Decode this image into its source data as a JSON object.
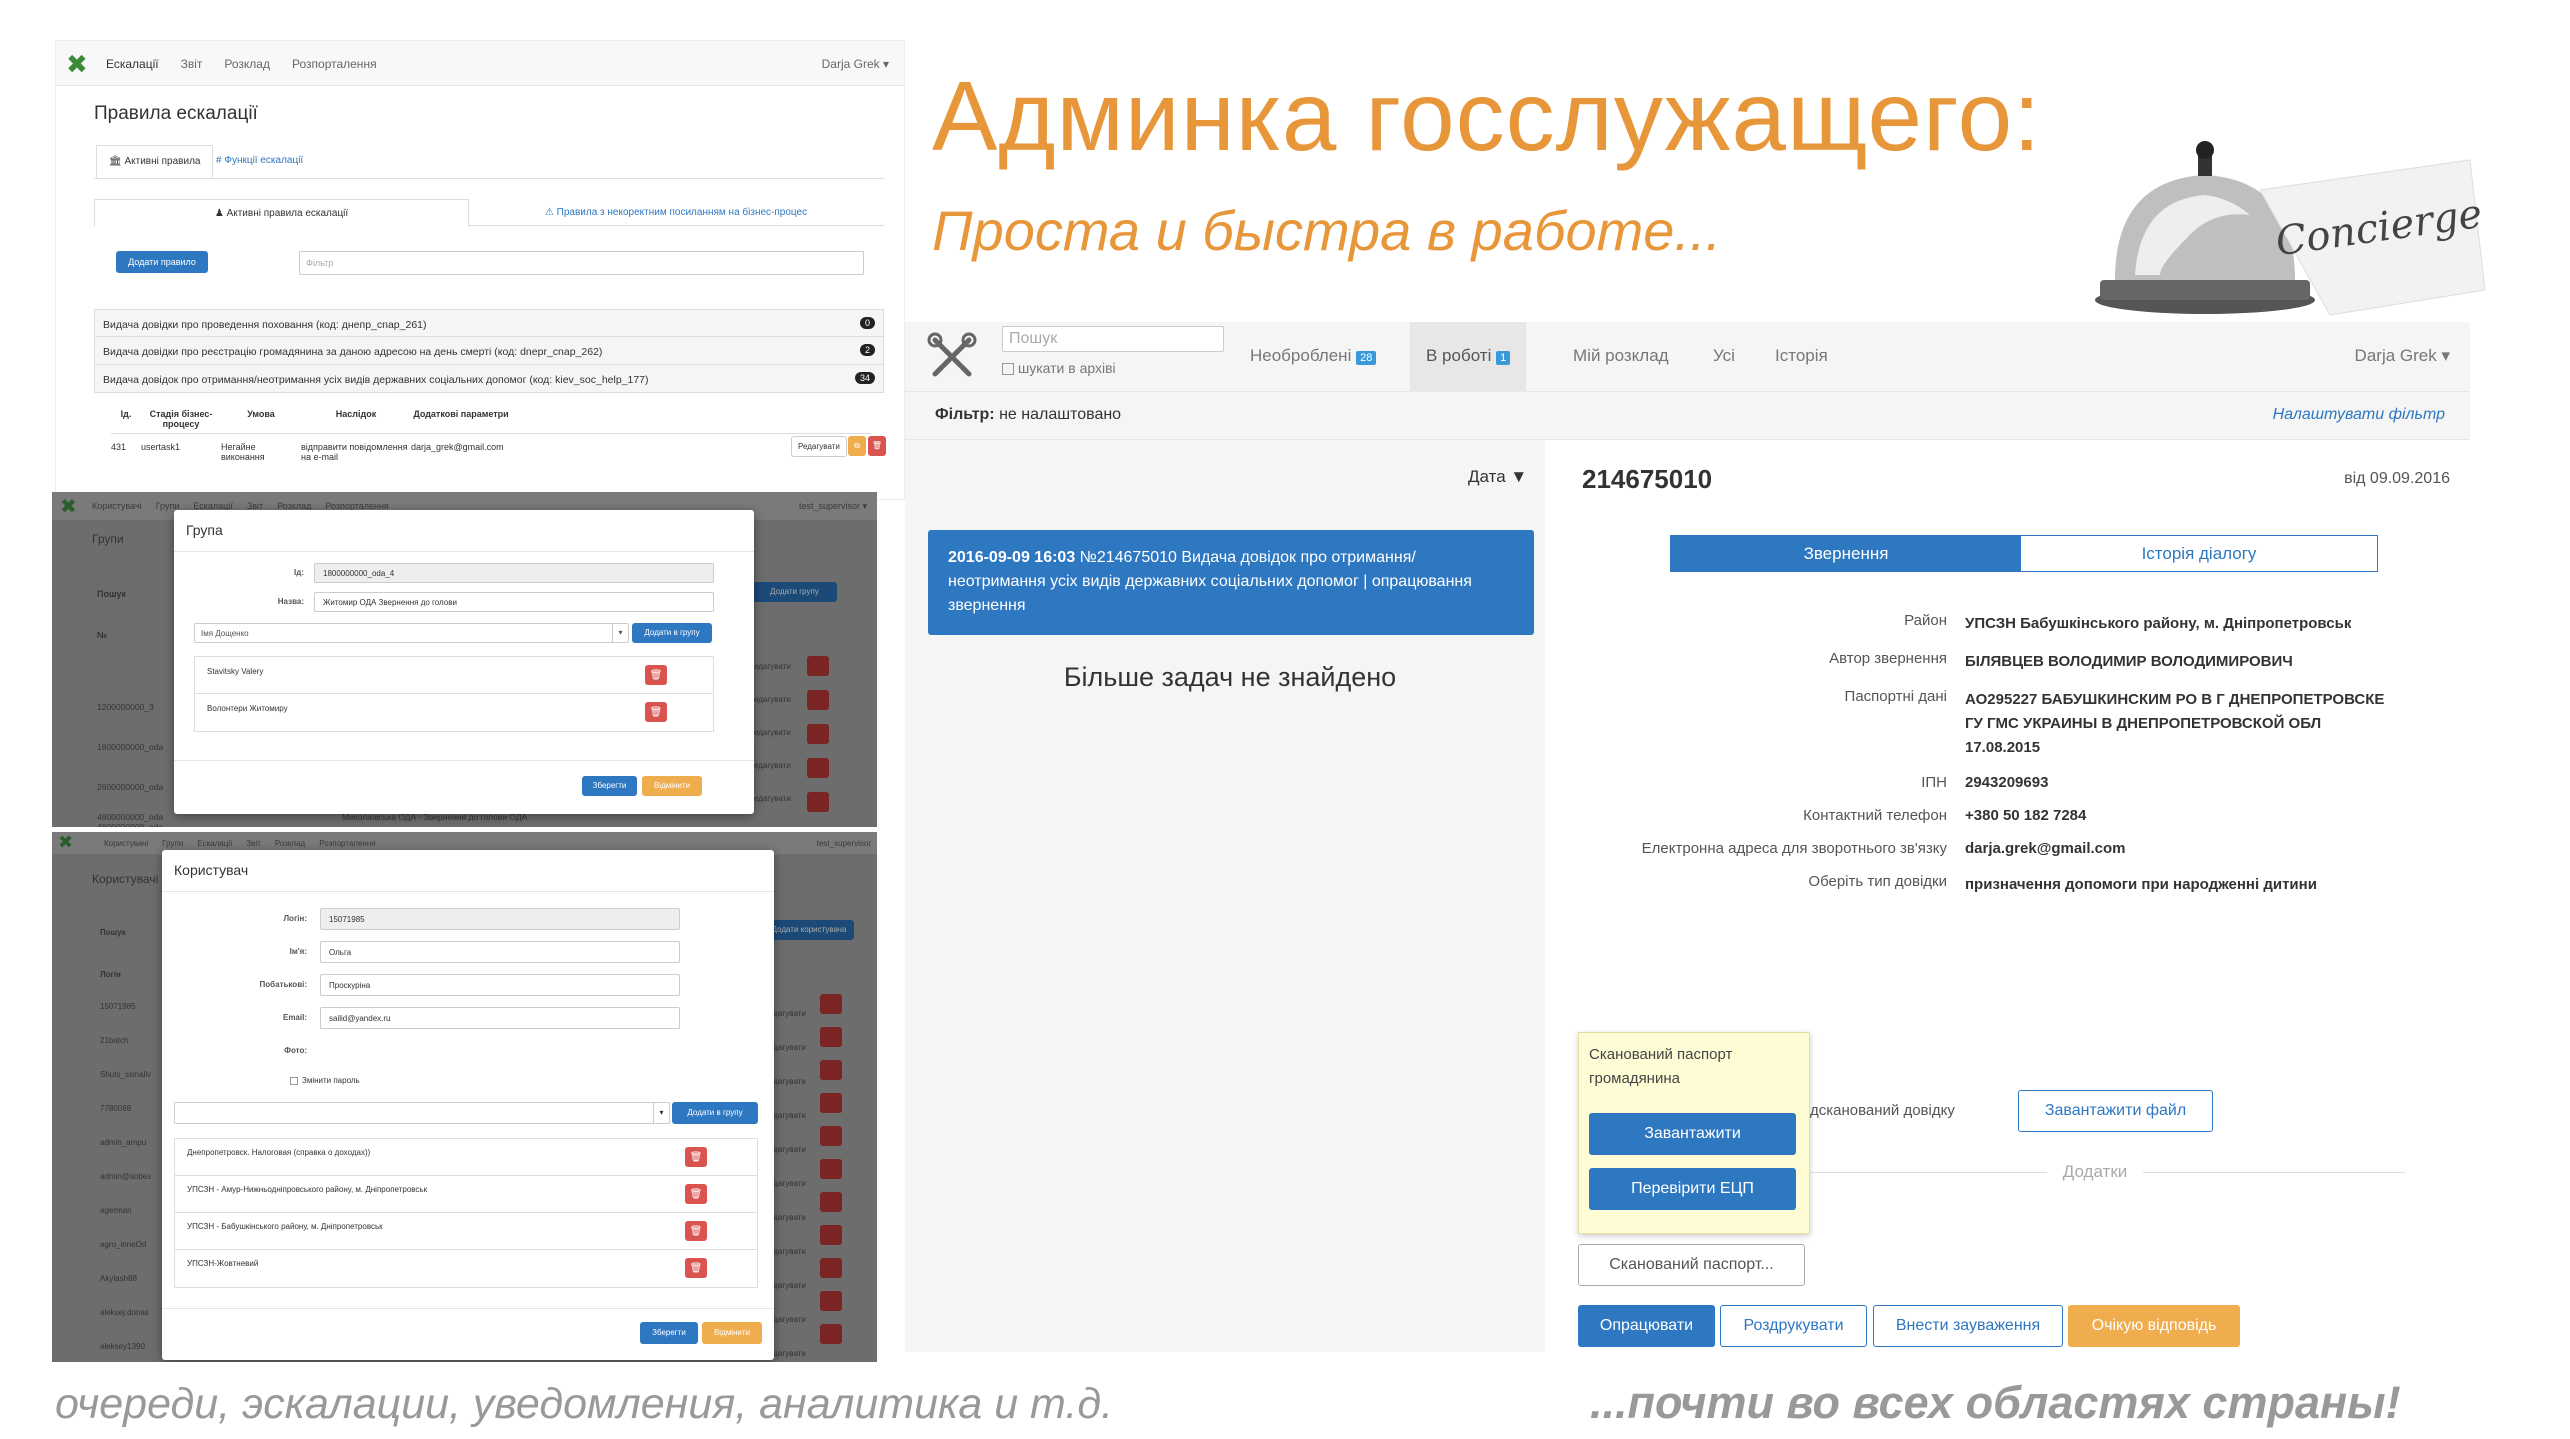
{
  "slide": {
    "title": "Админка госслужащего:",
    "subtitle": "Проста и быстра в работе...",
    "bottom_left": "очереди, эскалации, уведомления, аналитика и т.д.",
    "bottom_right": "...почти во всех областях страны!",
    "concierge": "Concierge"
  },
  "colors": {
    "accent": "#e8963a",
    "blue": "#2e77c1",
    "orange": "#f0ad4e",
    "red": "#d9534f"
  },
  "esc": {
    "nav": [
      "Ескалації",
      "Звіт",
      "Розклад",
      "Розпорталення"
    ],
    "user": "Darja Grek",
    "title": "Правила ескалації",
    "tabs": [
      "Активні правила",
      "Функції ескалації"
    ],
    "subtabs": [
      "Активні правила ескалації",
      "Правила з некоректним посиланням на бізнес-процес"
    ],
    "add_button": "Додати правило",
    "filter_placeholder": "Фільтр",
    "rules": [
      {
        "text": "Видача довідки про проведення поховання (код: днепр_cnap_261)",
        "count": "0"
      },
      {
        "text": "Видача довідки про реєстрацію громадянина за даною адресою на день смерті (код: dnepr_cnap_262)",
        "count": "2"
      },
      {
        "text": "Видача довідок про отримання/неотримання усіх видів державних соціальних допомог (код: kiev_soc_help_177)",
        "count": "34"
      }
    ],
    "table_headers": [
      "Ід.",
      "Стадія бізнес-процесу",
      "Умова",
      "Наслідок",
      "Додаткові параметри"
    ],
    "table_row": [
      "431",
      "usertask1",
      "Негайне виконання",
      "відправити повідомлення на e-mail",
      "darja_grek@gmail.com"
    ],
    "edit": "Редагувати"
  },
  "group": {
    "nav": [
      "Користувачі",
      "Групи",
      "Ескалації",
      "Звіт",
      "Розклад",
      "Розпорталення"
    ],
    "user": "test_supervisor",
    "bg_title": "Групи",
    "search": "Пошук",
    "id_col": "№",
    "bg_ids": [
      "1200000000_3",
      "1800000000_oda",
      "2600000000_oda",
      "4600000000_oda",
      "4800000000_oda"
    ],
    "bg_last": "Миколаївська ОДА - Звернення до голови ОДА",
    "add_group": "Додати групу",
    "edit": "Редагувати",
    "modal_title": "Група",
    "id_label": "Ід:",
    "id_value": "1800000000_oda_4",
    "name_label": "Назва:",
    "name_value": "Житомир ОДА Звернення до голови",
    "member_placeholder": "Імя Дощенко",
    "add_to_group": "Додати в групу",
    "members": [
      "Stavitsky Valery",
      "Волонтери Житомиру"
    ],
    "save": "Зберегти",
    "cancel": "Відмінити"
  },
  "user": {
    "nav": [
      "Користувачі",
      "Групи",
      "Ескалації",
      "Звіт",
      "Розклад",
      "Розпорталення"
    ],
    "user": "test_supervisor",
    "bg_title": "Користувачі",
    "search": "Пошук",
    "login_col": "Логін",
    "add_user": "Додати користувача",
    "edit": "Редагувати",
    "bg_logins": [
      "15071985",
      "21batch",
      "Shuts_ssinaliv",
      "7780068",
      "admin_ampu",
      "admin@sobes",
      "agerman",
      "agro_inneOd",
      "Akylash88",
      "aleksej.donas",
      "aleksey1390"
    ],
    "modal_title": "Користувач",
    "login_label": "Логін:",
    "login_value": "15071985",
    "name_label": "Ім'я:",
    "name_value": "Ольга",
    "patr_label": "Побатькові:",
    "patr_value": "Проскуріна",
    "email_label": "Email:",
    "email_value": "sailid@yandex.ru",
    "photo_label": "Фото:",
    "change_pwd": "Змінити пароль",
    "add_to_group": "Додати в групу",
    "groups": [
      "Днепропетровск. Налоговая (справка о доходах))",
      "УПСЗН - Амур-Нижньодніпровського району, м. Дніпропетровськ",
      "УПСЗН - Бабушкінського району, м. Дніпропетровськ",
      "УПСЗН-Жовтневий"
    ],
    "save": "Зберегти",
    "cancel": "Відмінити"
  },
  "main": {
    "search_placeholder": "Пошук",
    "archive": "шукати в архіві",
    "tabs": [
      {
        "label": "Необроблені",
        "badge": "28"
      },
      {
        "label": "В роботі",
        "badge": "1"
      },
      {
        "label": "Мій розклад",
        "badge": ""
      },
      {
        "label": "Усі",
        "badge": ""
      },
      {
        "label": "Історія",
        "badge": ""
      }
    ],
    "user": "Darja Grek",
    "filter_label": "Фільтр:",
    "filter_value": "не налаштовано",
    "configure_filter": "Налаштувати фільтр",
    "sort": "Дата ▼",
    "task_strong": "2016-09-09 16:03",
    "task_text": " №214675010 Видача довідок про отримання/ неотримання усіх видів державних соціальних допомог | опрацювання звернення",
    "no_more": "Більше задач не знайдено",
    "task_id": "214675010",
    "date": "від 09.09.2016",
    "detail_tabs": [
      "Звернення",
      "Історія діалогу"
    ],
    "fields": [
      {
        "label": "Район",
        "value": "УПСЗН Бабушкінського району, м. Дніпропетровськ"
      },
      {
        "label": "Автор звернення",
        "value": "БІЛЯВЦЕВ ВОЛОДИМИР ВОЛОДИМИРОВИЧ"
      },
      {
        "label": "Паспортні дані",
        "value": "АО295227 БАБУШКИНСКИМ РО В Г ДНЕПРОПЕТРОВСКЕ ГУ ГМС УКРАИНЫ В ДНЕПРОПЕТРОВСКОЙ ОБЛ 17.08.2015"
      },
      {
        "label": "ІПН",
        "value": "2943209693"
      },
      {
        "label": "Контактний телефон",
        "value": "+380 50 182 7284"
      },
      {
        "label": "Електронна адреса для зворотнього зв'язку",
        "value": "darja.grek@gmail.com"
      },
      {
        "label": "Оберіть тип довідки",
        "value": "призначення допомоги при народженні дитини"
      }
    ],
    "tooltip_title": "Сканований паспорт громадянина",
    "upload": "Завантажити",
    "verify": "Перевірити ЕЦП",
    "scanned_label": "дсканований довідку",
    "upload_file": "Завантажити файл",
    "attachments": "Додатки",
    "passport_btn": "Сканований паспорт...",
    "actions": [
      "Опрацювати",
      "Роздрукувати",
      "Внести зауваження",
      "Очікую відповідь"
    ]
  }
}
